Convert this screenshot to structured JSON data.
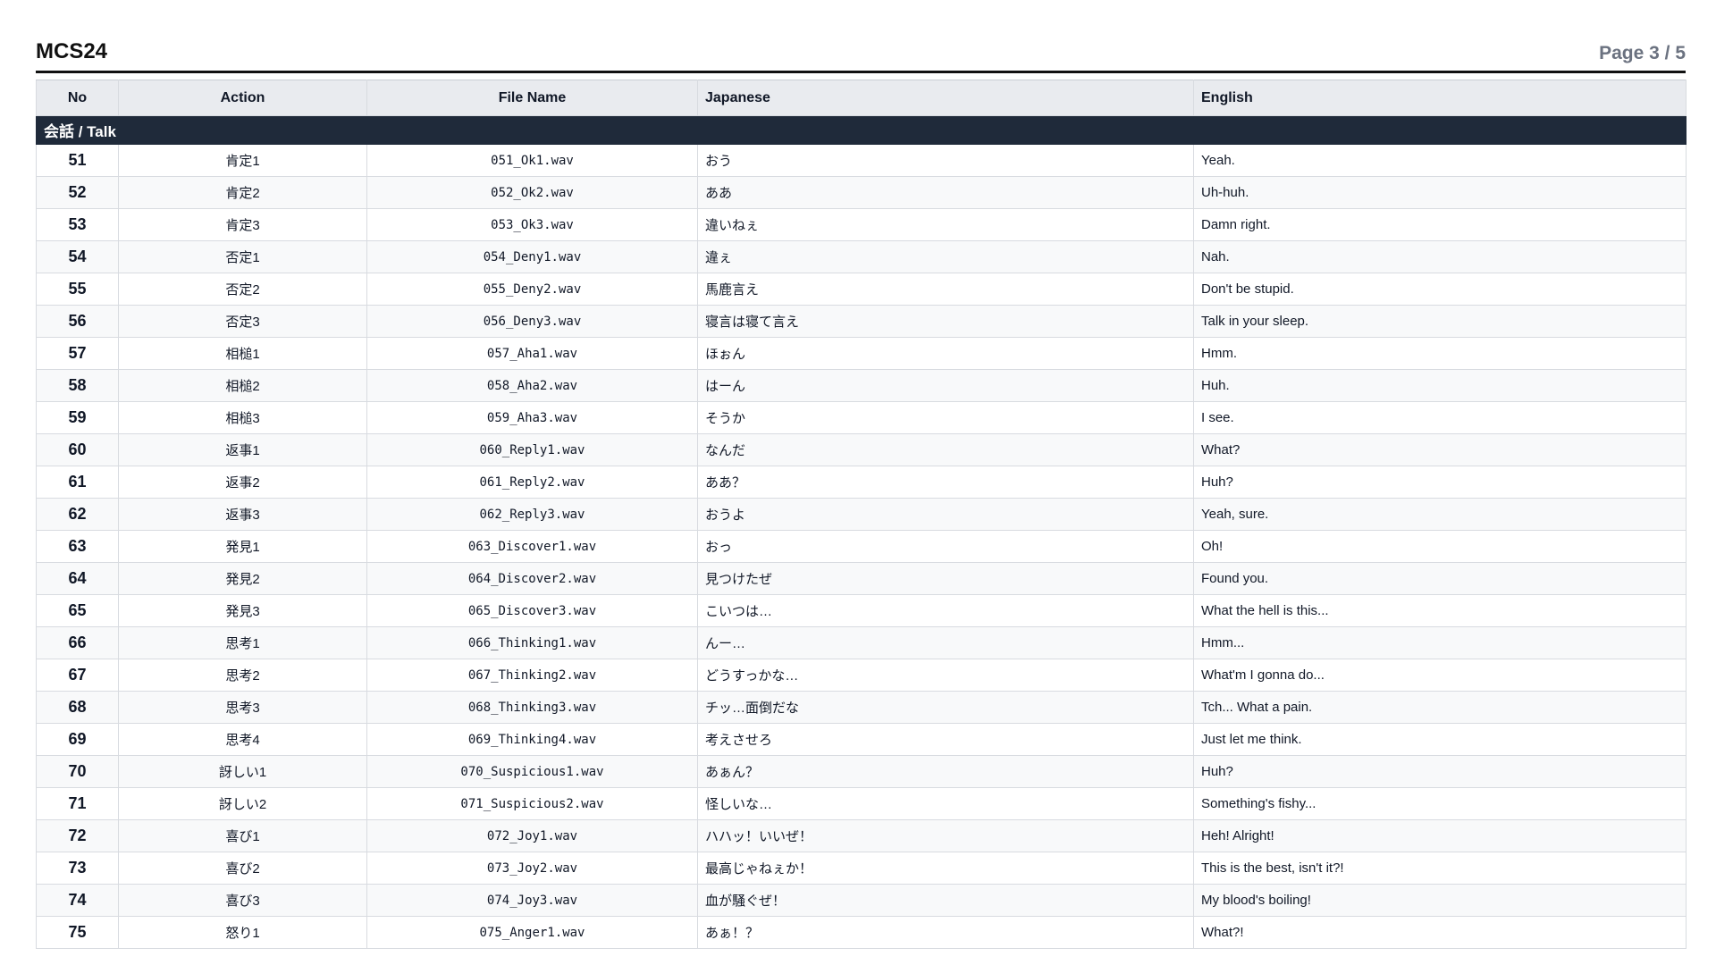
{
  "header": {
    "title": "MCS24",
    "page_label": "Page 3 / 5"
  },
  "table": {
    "columns": {
      "no": "No",
      "action": "Action",
      "file": "File Name",
      "japanese": "Japanese",
      "english": "English"
    },
    "section_label": "会話 / Talk",
    "rows": [
      {
        "no": "51",
        "action": "肯定1",
        "file": "051_Ok1.wav",
        "jp": "おう",
        "en": "Yeah."
      },
      {
        "no": "52",
        "action": "肯定2",
        "file": "052_Ok2.wav",
        "jp": "ああ",
        "en": "Uh-huh."
      },
      {
        "no": "53",
        "action": "肯定3",
        "file": "053_Ok3.wav",
        "jp": "違いねぇ",
        "en": "Damn right."
      },
      {
        "no": "54",
        "action": "否定1",
        "file": "054_Deny1.wav",
        "jp": "違ぇ",
        "en": "Nah."
      },
      {
        "no": "55",
        "action": "否定2",
        "file": "055_Deny2.wav",
        "jp": "馬鹿言え",
        "en": "Don't be stupid."
      },
      {
        "no": "56",
        "action": "否定3",
        "file": "056_Deny3.wav",
        "jp": "寝言は寝て言え",
        "en": "Talk in your sleep."
      },
      {
        "no": "57",
        "action": "相槌1",
        "file": "057_Aha1.wav",
        "jp": "ほぉん",
        "en": "Hmm."
      },
      {
        "no": "58",
        "action": "相槌2",
        "file": "058_Aha2.wav",
        "jp": "はーん",
        "en": "Huh."
      },
      {
        "no": "59",
        "action": "相槌3",
        "file": "059_Aha3.wav",
        "jp": "そうか",
        "en": "I see."
      },
      {
        "no": "60",
        "action": "返事1",
        "file": "060_Reply1.wav",
        "jp": "なんだ",
        "en": "What?"
      },
      {
        "no": "61",
        "action": "返事2",
        "file": "061_Reply2.wav",
        "jp": "ああ？",
        "en": "Huh?"
      },
      {
        "no": "62",
        "action": "返事3",
        "file": "062_Reply3.wav",
        "jp": "おうよ",
        "en": "Yeah, sure."
      },
      {
        "no": "63",
        "action": "発見1",
        "file": "063_Discover1.wav",
        "jp": "おっ",
        "en": "Oh!"
      },
      {
        "no": "64",
        "action": "発見2",
        "file": "064_Discover2.wav",
        "jp": "見つけたぜ",
        "en": "Found you."
      },
      {
        "no": "65",
        "action": "発見3",
        "file": "065_Discover3.wav",
        "jp": "こいつは…",
        "en": "What the hell is this..."
      },
      {
        "no": "66",
        "action": "思考1",
        "file": "066_Thinking1.wav",
        "jp": "んー…",
        "en": "Hmm..."
      },
      {
        "no": "67",
        "action": "思考2",
        "file": "067_Thinking2.wav",
        "jp": "どうすっかな…",
        "en": "What'm I gonna do..."
      },
      {
        "no": "68",
        "action": "思考3",
        "file": "068_Thinking3.wav",
        "jp": "チッ…面倒だな",
        "en": "Tch... What a pain."
      },
      {
        "no": "69",
        "action": "思考4",
        "file": "069_Thinking4.wav",
        "jp": "考えさせろ",
        "en": "Just let me think."
      },
      {
        "no": "70",
        "action": "訝しい1",
        "file": "070_Suspicious1.wav",
        "jp": "あぁん？",
        "en": "Huh?"
      },
      {
        "no": "71",
        "action": "訝しい2",
        "file": "071_Suspicious2.wav",
        "jp": "怪しいな…",
        "en": "Something's fishy..."
      },
      {
        "no": "72",
        "action": "喜び1",
        "file": "072_Joy1.wav",
        "jp": "ハハッ！いいぜ！",
        "en": "Heh! Alright!"
      },
      {
        "no": "73",
        "action": "喜び2",
        "file": "073_Joy2.wav",
        "jp": "最高じゃねぇか！",
        "en": "This is the best, isn't it?!"
      },
      {
        "no": "74",
        "action": "喜び3",
        "file": "074_Joy3.wav",
        "jp": "血が騒ぐぜ！",
        "en": "My blood's boiling!"
      },
      {
        "no": "75",
        "action": "怒り1",
        "file": "075_Anger1.wav",
        "jp": "あぁ！？",
        "en": "What?!"
      }
    ]
  }
}
